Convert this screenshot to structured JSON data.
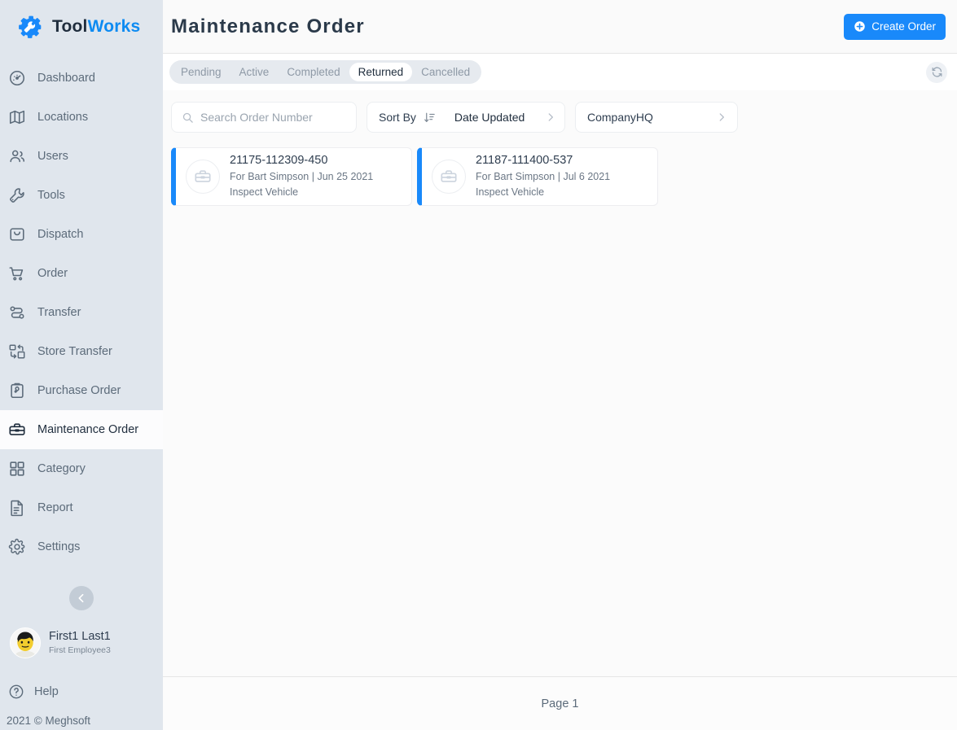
{
  "brand": {
    "name_part1": "Tool",
    "name_part2": "Works",
    "logo_icon": "gear-wrench-icon"
  },
  "sidebar": {
    "items": [
      {
        "label": "Dashboard",
        "icon": "speedometer-icon",
        "active": false
      },
      {
        "label": "Locations",
        "icon": "map-icon",
        "active": false
      },
      {
        "label": "Users",
        "icon": "users-icon",
        "active": false
      },
      {
        "label": "Tools",
        "icon": "wrench-icon",
        "active": false
      },
      {
        "label": "Dispatch",
        "icon": "bag-icon",
        "active": false
      },
      {
        "label": "Order",
        "icon": "shopping-cart-icon",
        "active": false
      },
      {
        "label": "Transfer",
        "icon": "transfer-icon",
        "active": false
      },
      {
        "label": "Store Transfer",
        "icon": "store-transfer-icon",
        "active": false
      },
      {
        "label": "Purchase Order",
        "icon": "clipboard-icon",
        "active": false
      },
      {
        "label": "Maintenance Order",
        "icon": "toolbox-icon",
        "active": true
      },
      {
        "label": "Category",
        "icon": "grid-icon",
        "active": false
      },
      {
        "label": "Report",
        "icon": "document-icon",
        "active": false
      },
      {
        "label": "Settings",
        "icon": "gear-icon",
        "active": false
      }
    ],
    "collapse_icon": "chevron-left-icon",
    "profile": {
      "name": "First1 Last1",
      "role": "First Employee3",
      "avatar_icon": "user-avatar"
    },
    "help": {
      "label": "Help",
      "icon": "question-circle-icon"
    },
    "copyright": "2021 © Meghsoft"
  },
  "header": {
    "title": "Maintenance Order",
    "create_button": {
      "label": "Create Order",
      "icon": "plus-circle-icon",
      "color": "#1989fa"
    }
  },
  "tabs": {
    "items": [
      {
        "label": "Pending",
        "active": false
      },
      {
        "label": "Active",
        "active": false
      },
      {
        "label": "Completed",
        "active": false
      },
      {
        "label": "Returned",
        "active": true
      },
      {
        "label": "Cancelled",
        "active": false
      }
    ],
    "refresh_icon": "refresh-icon"
  },
  "filters": {
    "search": {
      "placeholder": "Search Order Number",
      "value": "",
      "icon": "search-icon"
    },
    "sort": {
      "label": "Sort By",
      "icon": "sort-descending-icon",
      "value": "Date Updated",
      "chevron": "chevron-right-icon"
    },
    "company": {
      "value": "CompanyHQ",
      "chevron": "chevron-right-icon"
    }
  },
  "orders": [
    {
      "number": "21175-112309-450",
      "subtitle": "For Bart Simpson | Jun 25 2021",
      "task": "Inspect Vehicle",
      "icon": "toolbox-icon",
      "accent": "#1989fa"
    },
    {
      "number": "21187-111400-537",
      "subtitle": "For Bart Simpson | Jul 6 2021",
      "task": "Inspect Vehicle",
      "icon": "toolbox-icon",
      "accent": "#1989fa"
    }
  ],
  "footer": {
    "page_label": "Page 1"
  }
}
